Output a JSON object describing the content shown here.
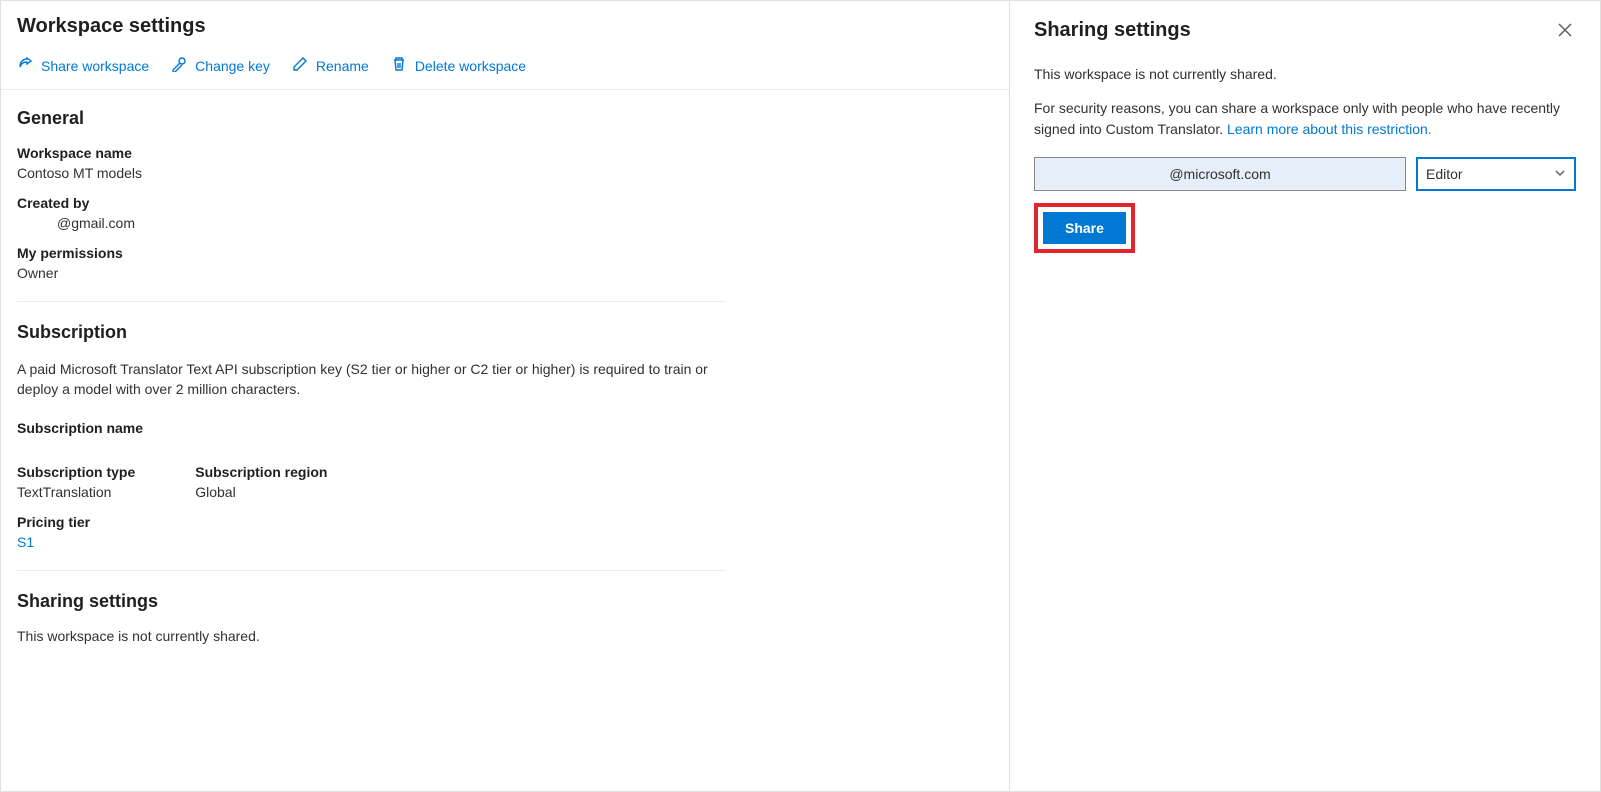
{
  "main": {
    "title": "Workspace settings",
    "toolbar": {
      "share": "Share workspace",
      "change_key": "Change key",
      "rename": "Rename",
      "delete": "Delete workspace"
    },
    "general": {
      "title": "General",
      "workspace_name_label": "Workspace name",
      "workspace_name_value": "Contoso MT models",
      "created_by_label": "Created by",
      "created_by_value": "@gmail.com",
      "permissions_label": "My permissions",
      "permissions_value": "Owner"
    },
    "subscription": {
      "title": "Subscription",
      "desc": "A paid Microsoft Translator Text API subscription key (S2 tier or higher or C2 tier or higher) is required to train or deploy a model with over 2 million characters.",
      "name_label": "Subscription name",
      "name_value": "",
      "type_label": "Subscription type",
      "type_value": "TextTranslation",
      "region_label": "Subscription region",
      "region_value": "Global",
      "tier_label": "Pricing tier",
      "tier_value": "S1"
    },
    "sharing": {
      "title": "Sharing settings",
      "status": "This workspace is not currently shared."
    }
  },
  "panel": {
    "title": "Sharing settings",
    "status": "This workspace is not currently shared.",
    "note_prefix": "For security reasons, you can share a workspace only with people who have recently signed into Custom Translator. ",
    "note_link": "Learn more about this restriction.",
    "email_value": "@microsoft.com",
    "role_value": "Editor",
    "share_label": "Share"
  }
}
